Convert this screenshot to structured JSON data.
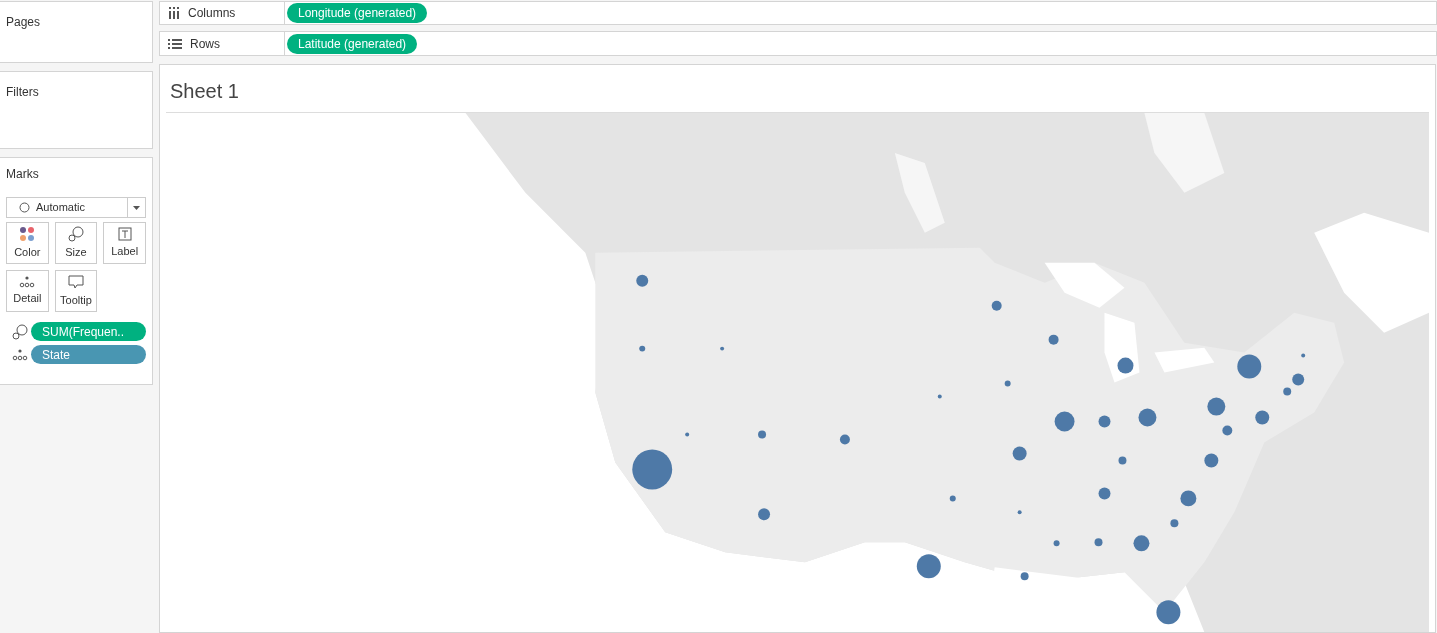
{
  "panels": [
    {
      "title": "Pages"
    },
    {
      "title": "Filters"
    }
  ],
  "marks": {
    "title": "Marks",
    "mark_type": "Automatic",
    "cards": [
      {
        "kind": "color",
        "label": "Color"
      },
      {
        "kind": "size",
        "label": "Size"
      },
      {
        "kind": "label",
        "label": "Label"
      },
      {
        "kind": "detail",
        "label": "Detail"
      },
      {
        "kind": "tooltip",
        "label": "Tooltip"
      }
    ],
    "fields": [
      {
        "kind": "size",
        "label": "SUM(Frequen..",
        "color": "#00b180"
      },
      {
        "kind": "detail",
        "label": "State",
        "color": "#4996b2"
      }
    ]
  },
  "shelves": [
    {
      "kind": "columns",
      "label": "Columns",
      "pill": "Longitude (generated)"
    },
    {
      "kind": "rows",
      "label": "Rows",
      "pill": "Latitude (generated)"
    }
  ],
  "sheet": {
    "title": "Sheet 1"
  }
}
